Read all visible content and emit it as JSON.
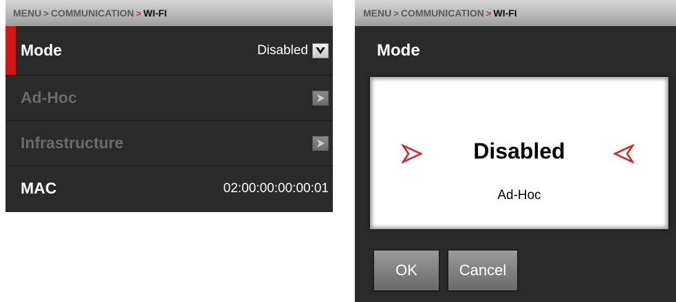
{
  "left_panel": {
    "breadcrumb": {
      "part1": "MENU",
      "sep1": ">",
      "part2": "COMMUNICATION",
      "sep2": ">",
      "current": "WI-FI"
    },
    "rows": [
      {
        "label": "Mode",
        "value": "Disabled",
        "icon": "chevron-down-icon"
      },
      {
        "label": "Ad-Hoc",
        "icon": "chevron-right-icon"
      },
      {
        "label": "Infrastructure",
        "icon": "chevron-right-icon"
      },
      {
        "label": "MAC",
        "value": "02:00:00:00:00:01"
      }
    ]
  },
  "right_panel": {
    "breadcrumb": {
      "part1": "MENU",
      "sep1": ">",
      "part2": "COMMUNICATION",
      "sep2": ">",
      "current": "WI-FI"
    },
    "dialog_title": "Mode",
    "picker": {
      "selected": "Disabled",
      "next": "Ad-Hoc"
    },
    "buttons": {
      "ok": "OK",
      "cancel": "Cancel"
    }
  },
  "colors": {
    "accent": "#d11818",
    "panel": "#2a2a2a",
    "dim_text": "#6b6b6b"
  }
}
